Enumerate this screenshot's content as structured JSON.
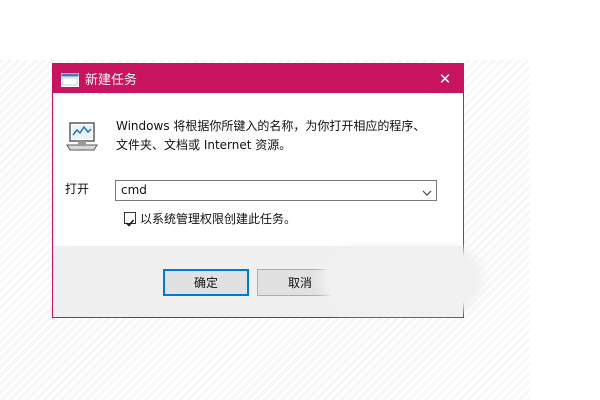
{
  "window": {
    "title": "新建任务",
    "close_glyph": "✕",
    "icons": {
      "title": "run-dialog-icon",
      "main": "monitor-icon",
      "dropdown": "chevron-down-icon"
    }
  },
  "prompt": {
    "line1": "Windows 将根据你所键入的名称，为你打开相应的程序、",
    "line2": "文件夹、文档或 Internet 资源。"
  },
  "open_field": {
    "label": "打开",
    "value": "cmd"
  },
  "admin_checkbox": {
    "checked": true,
    "label": "以系统管理权限创建此任务。"
  },
  "buttons": {
    "ok": "确定",
    "cancel": "取消"
  },
  "colors": {
    "accent": "#c8145e",
    "focus": "#0078d7"
  }
}
